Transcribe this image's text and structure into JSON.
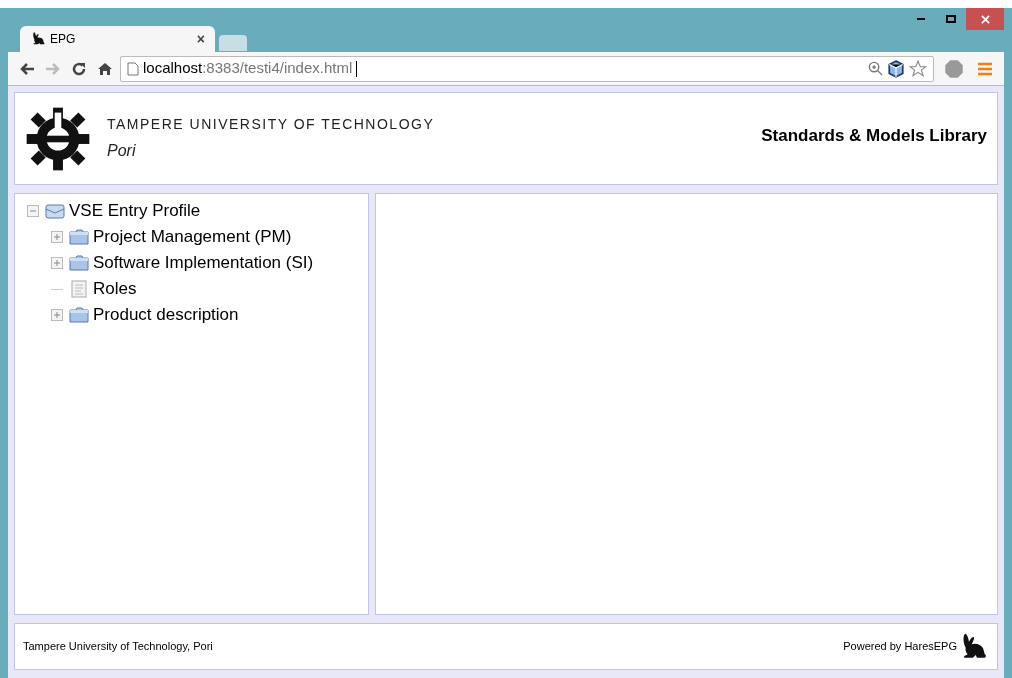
{
  "browser": {
    "tab_title": "EPG",
    "tab_close": "×",
    "url_host": "localhost",
    "url_rest": ":8383/testi4/index.html"
  },
  "header": {
    "institution": "TAMPERE UNIVERSITY OF TECHNOLOGY",
    "campus": "Pori",
    "title": "Standards & Models Library"
  },
  "tree": [
    {
      "label": "VSE Entry Profile",
      "kind": "package",
      "expanded": true,
      "children": [
        {
          "label": "Project Management (PM)",
          "kind": "folder",
          "expanded": false
        },
        {
          "label": "Software Implementation (SI)",
          "kind": "folder",
          "expanded": false
        },
        {
          "label": "Roles",
          "kind": "page"
        },
        {
          "label": "Product description",
          "kind": "folder",
          "expanded": false
        }
      ]
    }
  ],
  "footer": {
    "left": "Tampere University of Technology, Pori",
    "right": "Powered by HaresEPG"
  }
}
